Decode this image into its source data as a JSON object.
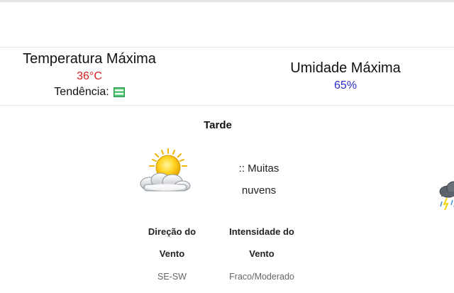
{
  "summary": {
    "temperature": {
      "title": "Temperatura Máxima",
      "value": "36°C",
      "value_color": "#d62020",
      "trend_label": "Tendência:",
      "trend_icon": "stable-trend-icon"
    },
    "humidity": {
      "title": "Umidade Máxima",
      "value": "65%",
      "value_color": "#2b2bc8"
    }
  },
  "period": {
    "title": "Tarde",
    "weather_icon": "partly-cloudy-sun-icon",
    "condition_line1": ":: Muitas",
    "condition_line2": "nuvens",
    "wind_direction": {
      "label_line1": "Direção do",
      "label_line2": "Vento",
      "value": "SE-SW"
    },
    "wind_intensity": {
      "label_line1": "Intensidade do",
      "label_line2": "Vento",
      "value": "Fraco/Moderado"
    }
  },
  "next_period": {
    "weather_icon": "thunderstorm-cloud-icon"
  }
}
